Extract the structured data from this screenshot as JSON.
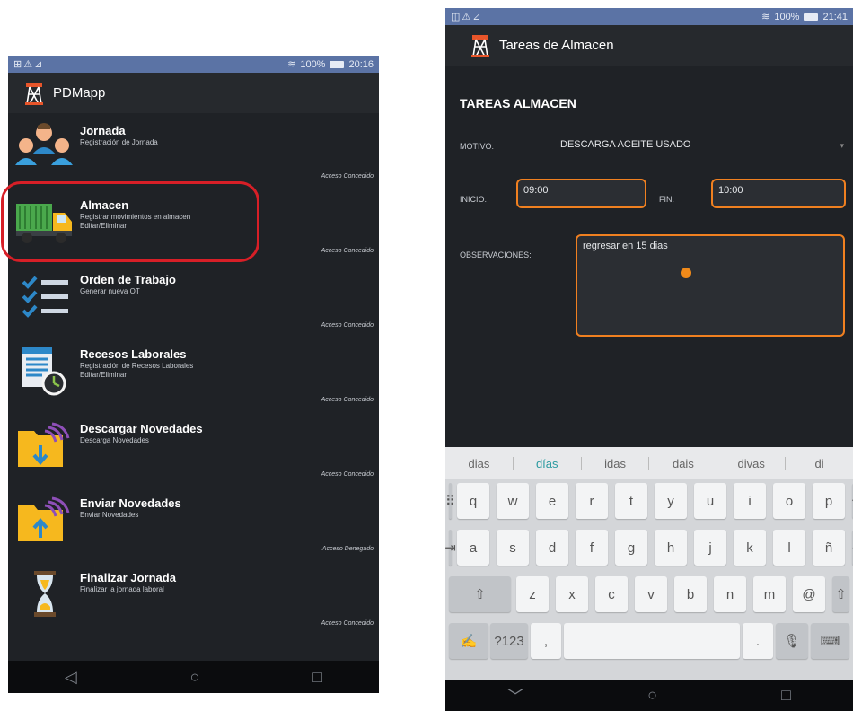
{
  "left": {
    "status": {
      "left_icons": "⊞⚠⊿",
      "battery": "100%",
      "time": "20:16"
    },
    "app_title": "PDMapp",
    "items": [
      {
        "title": "Jornada",
        "subtitle": "Registración de Jornada",
        "access": "Acceso Concedido"
      },
      {
        "title": "Almacen",
        "subtitle": "Registrar movimientos en almacen\nEditar/Eliminar",
        "access": "Acceso Concedido"
      },
      {
        "title": "Orden de Trabajo",
        "subtitle": "Generar nueva OT",
        "access": "Acceso Concedido"
      },
      {
        "title": "Recesos Laborales",
        "subtitle": "Registración de Recesos Laborales\nEditar/Eliminar",
        "access": "Acceso Concedido"
      },
      {
        "title": "Descargar Novedades",
        "subtitle": "Descarga Novedades",
        "access": "Acceso Concedido"
      },
      {
        "title": "Enviar Novedades",
        "subtitle": "Enviar Novedades",
        "access": "Acceso Denegado"
      },
      {
        "title": "Finalizar Jornada",
        "subtitle": "Finalizar la jornada laboral",
        "access": "Acceso Concedido"
      }
    ]
  },
  "right": {
    "status": {
      "left_icons": "◫⚠⊿",
      "battery": "100%",
      "time": "21:41"
    },
    "app_title": "Tareas de Almacen",
    "form_title": "TAREAS ALMACEN",
    "motivo_label": "MOTIVO:",
    "motivo_value": "DESCARGA ACEITE USADO",
    "inicio_label": "INICIO:",
    "inicio_value": "09:00",
    "fin_label": "FIN:",
    "fin_value": "10:00",
    "obs_label": "OBSERVACIONES:",
    "obs_value": "regresar en 15 dias",
    "suggestions": [
      "dias",
      "días",
      "idas",
      "dais",
      "divas",
      "di"
    ],
    "keys_row1": [
      "q",
      "w",
      "e",
      "r",
      "t",
      "y",
      "u",
      "i",
      "o",
      "p"
    ],
    "keys_row2": [
      "a",
      "s",
      "d",
      "f",
      "g",
      "h",
      "j",
      "k",
      "l",
      "ñ"
    ],
    "keys_row3": [
      "z",
      "x",
      "c",
      "v",
      "b",
      "n",
      "m",
      "@"
    ],
    "key_symbols": "?123",
    "key_comma": ",",
    "key_period": "."
  },
  "colors": {
    "highlight_ring": "#d71f27",
    "input_border": "#f08020",
    "status_bar": "#5b73a5"
  }
}
